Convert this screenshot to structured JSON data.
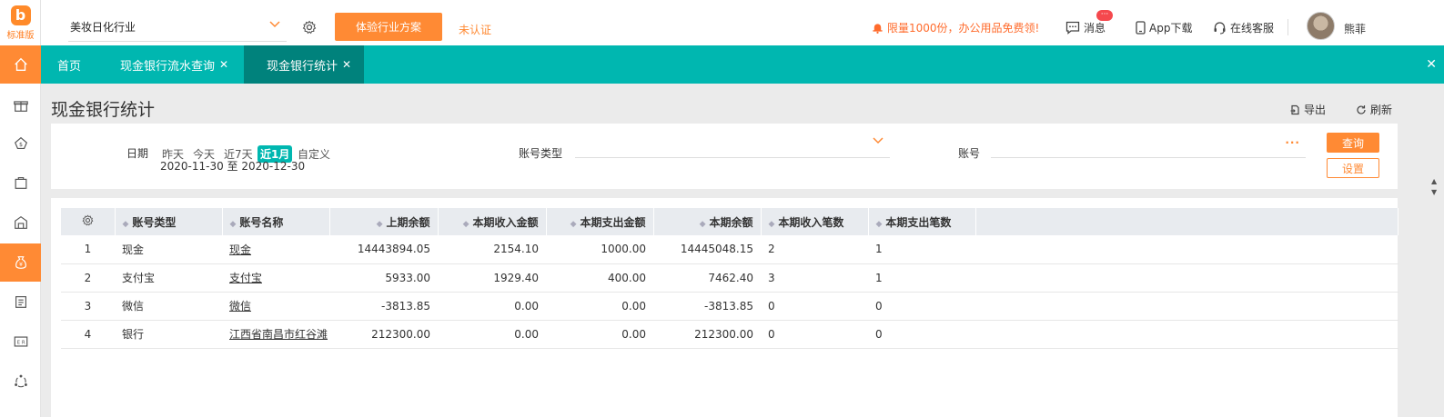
{
  "logo": {
    "mark": "b",
    "version": "标准版"
  },
  "topbar": {
    "industry": "美妆日化行业",
    "trial_button": "体验行业方案",
    "unverified": "未认证",
    "promo": "限量1000份，办公用品免费领!",
    "messages": "消息",
    "messages_badge": "···",
    "app_download": "App下载",
    "online_service": "在线客服",
    "username": "熊菲"
  },
  "tabs": [
    {
      "label": "首页"
    },
    {
      "label": "现金银行流水查询"
    },
    {
      "label": "现金银行统计"
    }
  ],
  "page": {
    "title": "现金银行统计",
    "export": "导出",
    "refresh": "刷新"
  },
  "filter": {
    "date_label": "日期",
    "quick_ranges": [
      "昨天",
      "今天",
      "近7天",
      "近1月",
      "自定义"
    ],
    "active_range": "近1月",
    "range_text": "2020-11-30 至 2020-12-30",
    "account_type_label": "账号类型",
    "account_type_value": "",
    "account_label": "账号",
    "account_value": "",
    "query_button": "查询",
    "setting_button": "设置"
  },
  "table": {
    "headers": [
      "账号类型",
      "账号名称",
      "上期余额",
      "本期收入金额",
      "本期支出金额",
      "本期余额",
      "本期收入笔数",
      "本期支出笔数"
    ],
    "rows": [
      {
        "idx": "1",
        "type": "现金",
        "name": "现金",
        "prev": "14443894.05",
        "income": "2154.10",
        "expense": "1000.00",
        "balance": "14445048.15",
        "in_count": "2",
        "out_count": "1"
      },
      {
        "idx": "2",
        "type": "支付宝",
        "name": "支付宝",
        "prev": "5933.00",
        "income": "1929.40",
        "expense": "400.00",
        "balance": "7462.40",
        "in_count": "3",
        "out_count": "1"
      },
      {
        "idx": "3",
        "type": "微信",
        "name": "微信",
        "prev": "-3813.85",
        "income": "0.00",
        "expense": "0.00",
        "balance": "-3813.85",
        "in_count": "0",
        "out_count": "0"
      },
      {
        "idx": "4",
        "type": "银行",
        "name": "江西省南昌市红谷滩",
        "prev": "212300.00",
        "income": "0.00",
        "expense": "0.00",
        "balance": "212300.00",
        "in_count": "0",
        "out_count": "0"
      }
    ]
  },
  "colors": {
    "accent": "#ff8a34",
    "teal": "#00b7b0",
    "teal_dark": "#00827c"
  }
}
